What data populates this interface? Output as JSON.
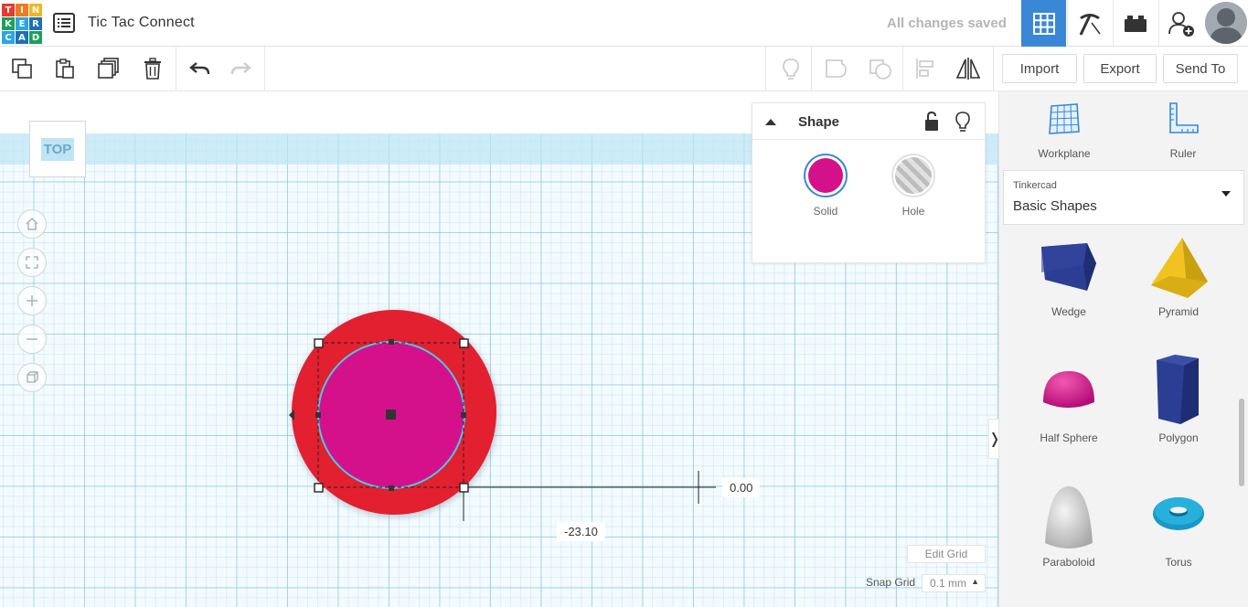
{
  "logo_letters": [
    "T",
    "I",
    "N",
    "K",
    "E",
    "R",
    "C",
    "A",
    "D"
  ],
  "logo_colors": [
    "#e8392e",
    "#f07a1f",
    "#f2b520",
    "#1da05a",
    "#2aa7e0",
    "#1d70b7",
    "#2aa7e0",
    "#1d70b7",
    "#1da05a"
  ],
  "header": {
    "title": "Tic Tac Connect",
    "save_status": "All changes saved"
  },
  "toolbar": {
    "import_label": "Import",
    "export_label": "Export",
    "send_to_label": "Send To"
  },
  "view_cube_label": "TOP",
  "shape_panel": {
    "title": "Shape",
    "solid_label": "Solid",
    "hole_label": "Hole",
    "solid_color": "#d4118b"
  },
  "dimensions": {
    "x_value": "0.00",
    "y_value": "-23.10"
  },
  "grid": {
    "edit_label": "Edit Grid",
    "snap_label": "Snap Grid",
    "snap_value": "0.1 mm"
  },
  "sidebar": {
    "workplane_label": "Workplane",
    "ruler_label": "Ruler",
    "library_source": "Tinkercad",
    "library_name": "Basic Shapes",
    "shapes": [
      {
        "label": "Wedge",
        "icon": "wedge-icon"
      },
      {
        "label": "Pyramid",
        "icon": "pyramid-icon"
      },
      {
        "label": "Half Sphere",
        "icon": "half-sphere-icon"
      },
      {
        "label": "Polygon",
        "icon": "polygon-icon"
      },
      {
        "label": "Paraboloid",
        "icon": "paraboloid-icon"
      },
      {
        "label": "Torus",
        "icon": "torus-icon"
      }
    ]
  },
  "colors": {
    "accent": "#3a87d6",
    "red_disc": "#e2202f",
    "magenta_disc": "#d4118b"
  }
}
